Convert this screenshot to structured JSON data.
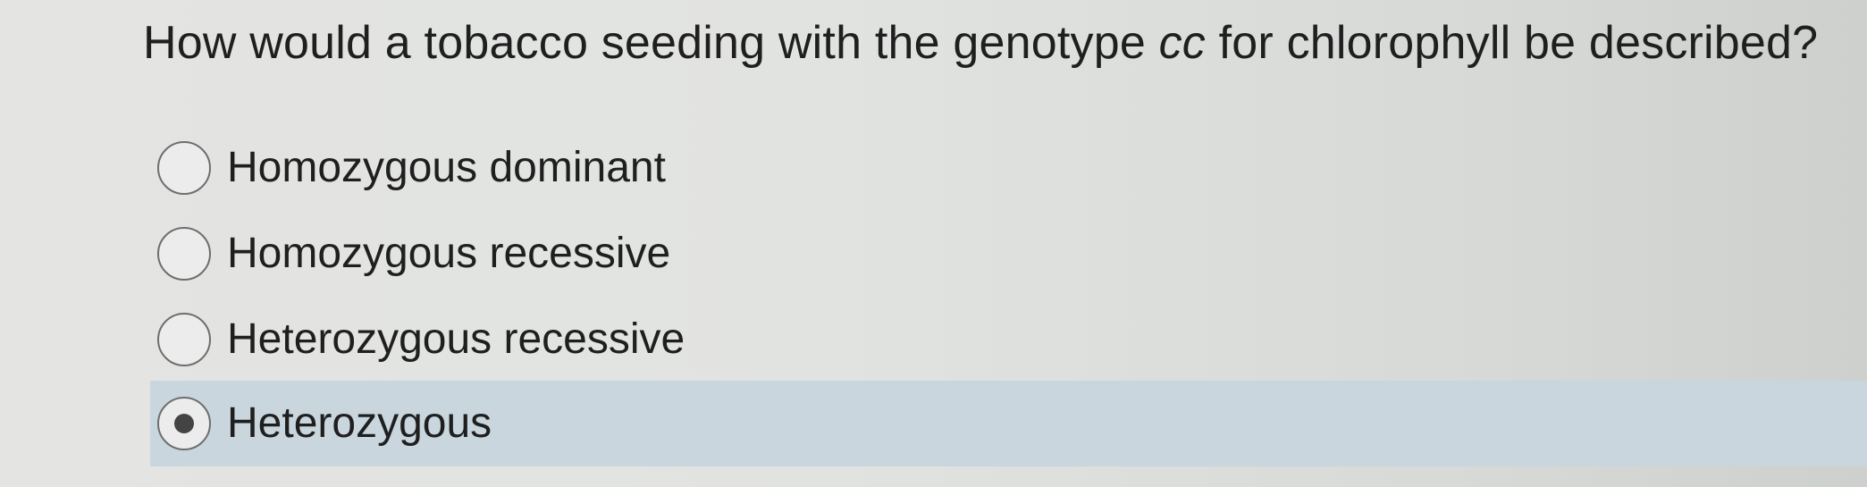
{
  "question": {
    "before": "How would a tobacco seeding with the genotype ",
    "emphasis": "cc",
    "after": " for chlorophyll be described?"
  },
  "options": [
    {
      "label": "Homozygous dominant",
      "selected": false
    },
    {
      "label": "Homozygous recessive",
      "selected": false
    },
    {
      "label": "Heterozygous recessive",
      "selected": false
    },
    {
      "label": "Heterozygous",
      "selected": true
    }
  ]
}
